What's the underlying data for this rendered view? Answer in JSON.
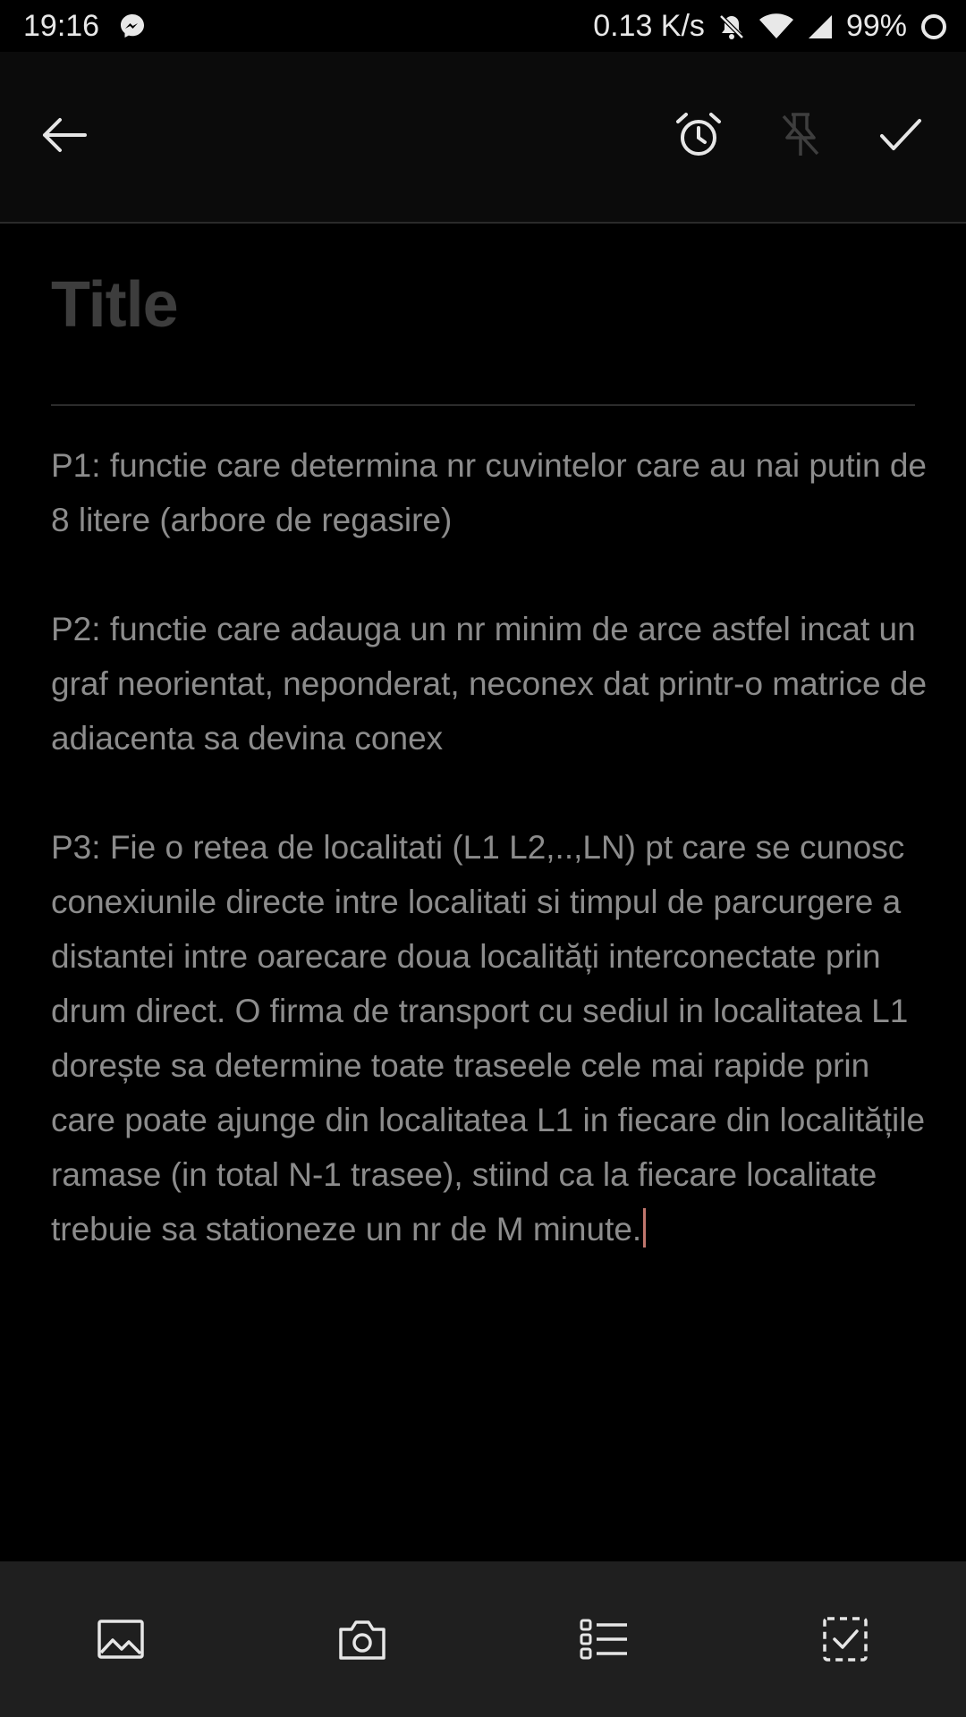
{
  "status_bar": {
    "time": "19:16",
    "net_speed": "0.13 K/s",
    "battery": "99%",
    "icons": [
      "messenger-icon",
      "mute-bell-icon",
      "wifi-icon",
      "signal-icon",
      "battery-ring-icon"
    ]
  },
  "toolbar": {
    "icons": [
      "back-arrow-icon",
      "alarm-icon",
      "unpin-icon",
      "check-icon"
    ]
  },
  "note": {
    "title_placeholder": "Title",
    "paragraphs": [
      "P1: functie care determina nr cuvintelor care au nai putin de 8 litere (arbore de regasire)",
      "P2: functie care adauga un nr minim de arce astfel incat un graf neorientat, neponderat, neconex dat printr-o matrice de adiacenta sa devina conex",
      "P3:  Fie o retea de localitati (L1 L2,..,LN) pt care se cunosc conexiunile directe intre localitati si timpul de parcurgere a distantei intre oarecare doua localități interconectate prin drum direct. O firma de transport cu sediul in localitatea L1 dorește sa determine toate traseele cele mai rapide prin care poate ajunge din localitatea L1 in fiecare din localitățile ramase (in total N-1 trasee), stiind ca la fiecare localitate trebuie sa stationeze un nr de M minute."
    ]
  },
  "bottom_toolbar": {
    "icons": [
      "image-icon",
      "camera-icon",
      "bulleted-list-icon",
      "checklist-icon"
    ]
  },
  "colors": {
    "background": "#000000",
    "appbar": "#0b0b0b",
    "bottombar": "#1f1f1f",
    "body_text": "#8c8c8c",
    "title_placeholder": "#3d3d3d",
    "caret": "#c0766d"
  }
}
